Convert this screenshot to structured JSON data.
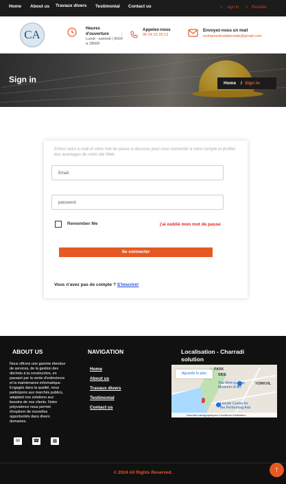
{
  "topbar": {
    "nav": [
      "Home",
      "About us",
      "Travaux divers",
      "Testimonial",
      "Contact us"
    ],
    "arrow": ">",
    "signin_label": "sign in",
    "register_label": "Resister"
  },
  "header": {
    "logo_text": "CA",
    "hours": {
      "title": "Heures d'ouverture",
      "text": "Lundi - samedi | 9h00 à 18h00"
    },
    "phone": {
      "title": "Appelez-nous",
      "text": "06 24 15 29 13"
    },
    "email": {
      "title": "Envoyez-nous un mail",
      "text": "mohamedredabentaib@gmail.com"
    },
    "icons": [
      "clock-icon",
      "phone-icon",
      "envelope-icon"
    ]
  },
  "hero": {
    "title": "Sign in",
    "breadcrumb": {
      "home": "Home",
      "separator": "/",
      "current": "Sign in"
    }
  },
  "form": {
    "intro": "Entrez votre e-mail et votre mot de passe ci-dessous pour vous connecter à votre compte et profiter des avantages de notre site Web.",
    "email_placeholder": "Email",
    "password_placeholder": "password",
    "remember_label": "Remember Me",
    "forgot_label": "j'ai oublié mon mot de passe",
    "submit_label": "Se connecter",
    "no_account_text": "Vous n'avez pas de compte ?",
    "signup_label": "S'inscrire!"
  },
  "footer": {
    "about_title": "ABOUT US",
    "about_text": "Nous offrons une gamme étendue de services, de la gestion des déchets à la construction, en passant par la vente d'extincteurs et la maintenance informatique. Engagés dans la qualité, nous participons aux marchés publics, adaptant nos solutions aux besoins de nos clients. Notre polyvalence nous permet d'explorer de nouvelles opportunités dans divers domaines.",
    "social_icons": [
      "envelope-icon",
      "phone-icon",
      "building-icon"
    ],
    "nav_title": "NAVIGATION",
    "nav_items": [
      "Home",
      "About us",
      "Travaux divers",
      "Testimonial",
      "Contact us"
    ],
    "map_title": "Localisation - Charradi solution",
    "map": {
      "enlarge_label": "Agrandir le plan",
      "labels": [
        "PARK",
        "SIDE",
        "The Metropolitan Museum of Art",
        "YORKVIL",
        "Lincoln Center for the Performing Arts"
      ],
      "footer_text": "Données cartographiques   Conditions d'utilisation"
    },
    "copyright": "© 2024 All Rights Reserved.",
    "back_to_top_icon": "arrow-up-icon"
  },
  "colors": {
    "accent": "#e55a24",
    "link_red": "#e2231a",
    "dark": "#1b1b1b",
    "link_blue": "#1f4bd8"
  }
}
